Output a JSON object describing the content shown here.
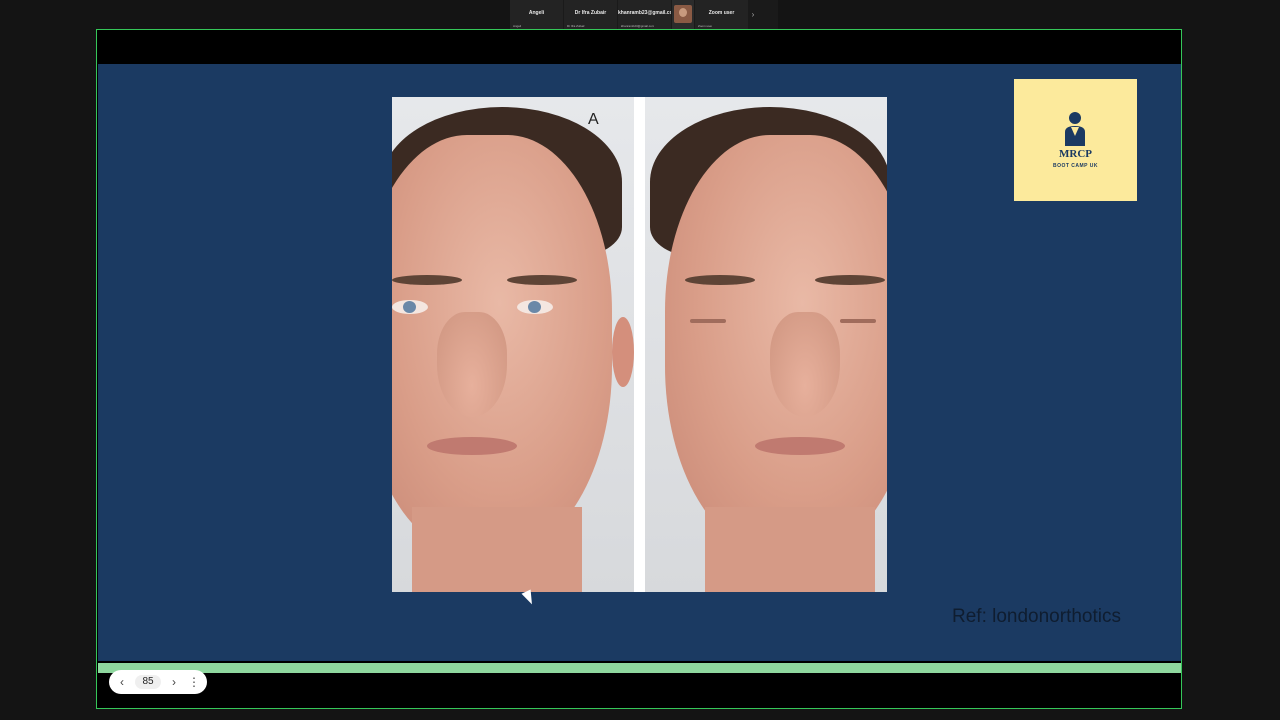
{
  "participants": [
    {
      "name": "Angeli",
      "sub": "Angeli"
    },
    {
      "name": "Dr Ifra Zubair",
      "sub": "Dr Ifra Zubair"
    },
    {
      "name": "khanramb23@gmail.com",
      "sub": "khanramb23@gmail.com"
    },
    {
      "name": "",
      "sub": ""
    },
    {
      "name": "Zoom user",
      "sub": "Zoom user"
    }
  ],
  "slide": {
    "panel_label": "A",
    "logo_title": "MRCP",
    "logo_subtitle": "BOOT CAMP UK",
    "reference": "Ref: londonorthotics"
  },
  "nav": {
    "prev_icon": "‹",
    "page": "85",
    "next_icon": "›",
    "more_icon": "⋮"
  },
  "colors": {
    "slide_background": "#1b3a62",
    "share_border": "#35c759",
    "logo_background": "#fcea9c",
    "progress": "#8fd89f"
  }
}
